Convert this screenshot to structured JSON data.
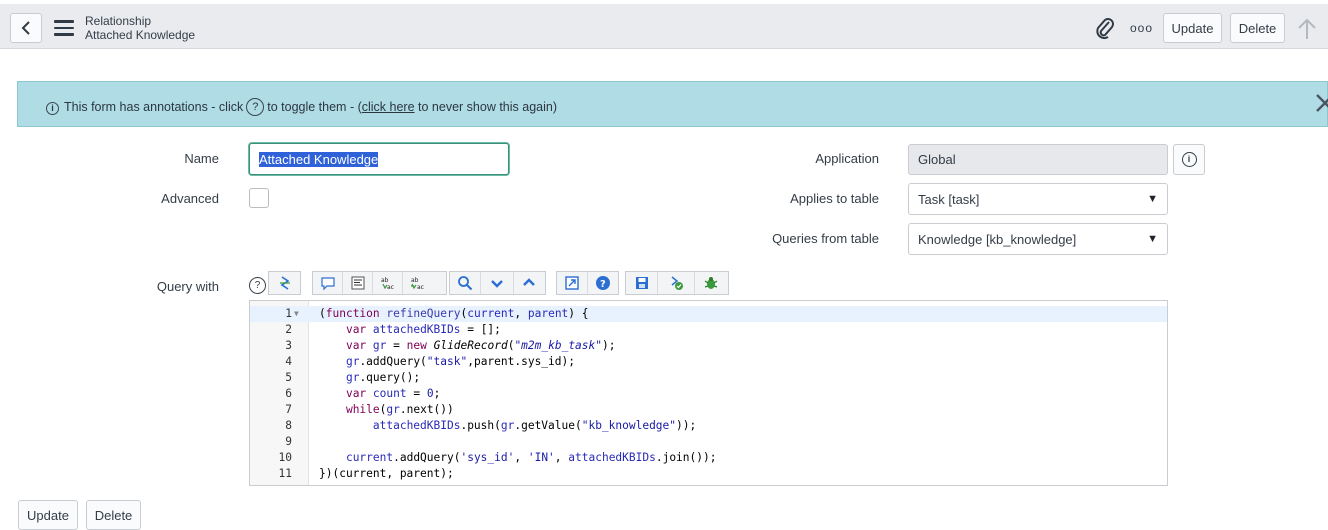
{
  "header": {
    "record_type": "Relationship",
    "record_name": "Attached Knowledge",
    "more_label": "ooo",
    "update_label": "Update",
    "delete_label": "Delete"
  },
  "banner": {
    "text_before": "This form has annotations - click",
    "help_glyph": "?",
    "text_middle": "to toggle them - (",
    "link_text": "click here",
    "text_after": " to never show this again)"
  },
  "form": {
    "name_label": "Name",
    "name_value": "Attached Knowledge",
    "advanced_label": "Advanced",
    "application_label": "Application",
    "application_value": "Global",
    "applies_label": "Applies to table",
    "applies_value": "Task [task]",
    "queries_label": "Queries from table",
    "queries_value": "Knowledge [kb_knowledge]",
    "query_with_label": "Query with"
  },
  "toolbar_icons": [
    "toggle-syntax-icon",
    "comment-icon",
    "format-icon",
    "replace-icon",
    "replace-all-icon",
    "search-icon",
    "chevron-down-icon",
    "chevron-up-icon",
    "fullscreen-icon",
    "help-icon",
    "save-icon",
    "script-check-icon",
    "debug-icon"
  ],
  "code_lines": [
    {
      "n": "1",
      "text": "(function refineQuery(current, parent) {"
    },
    {
      "n": "2",
      "text": "    var attachedKBIDs = [];"
    },
    {
      "n": "3",
      "text": "    var gr = new GlideRecord(\"m2m_kb_task\");"
    },
    {
      "n": "4",
      "text": "    gr.addQuery(\"task\",parent.sys_id);"
    },
    {
      "n": "5",
      "text": "    gr.query();"
    },
    {
      "n": "6",
      "text": "    var count = 0;"
    },
    {
      "n": "7",
      "text": "    while(gr.next())"
    },
    {
      "n": "8",
      "text": "        attachedKBIDs.push(gr.getValue(\"kb_knowledge\"));"
    },
    {
      "n": "9",
      "text": ""
    },
    {
      "n": "10",
      "text": "    current.addQuery('sys_id', 'IN', attachedKBIDs.join());"
    },
    {
      "n": "11",
      "text": "})(current, parent);"
    }
  ],
  "footer": {
    "update_label": "Update",
    "delete_label": "Delete"
  },
  "colors": {
    "banner_bg": "#b0dde5",
    "focus_border": "#3d8f7a",
    "selection": "#2f62d8",
    "keyword": "#7f0055"
  }
}
